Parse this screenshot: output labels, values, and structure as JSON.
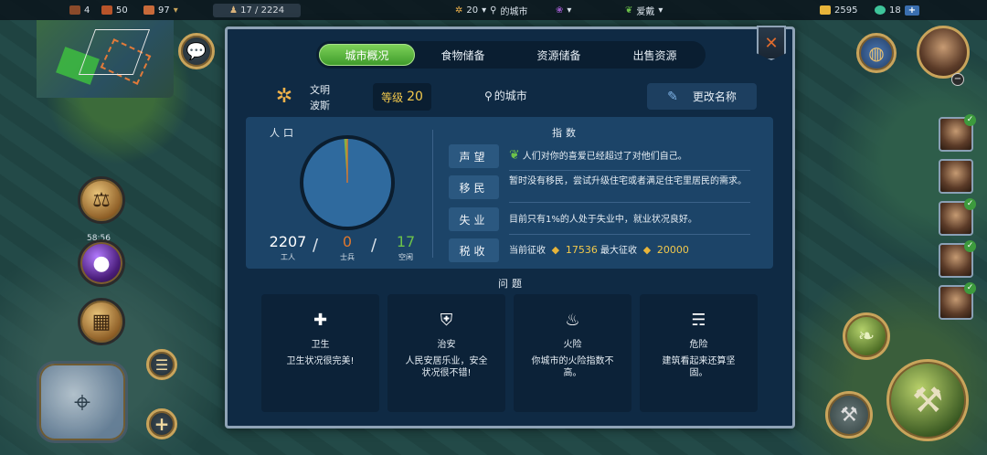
{
  "topbar": {
    "resource_a": "4",
    "resource_b": "50",
    "resource_c": "97",
    "population_counter": "17 / 2224",
    "civ_level": "20",
    "city_label": "的城市",
    "leader_label": "爱戴",
    "gold": "2595",
    "gems": "18",
    "add_label": "+"
  },
  "left": {
    "orb_timer": "58:56"
  },
  "tabs": [
    {
      "label": "城市概况",
      "active": true
    },
    {
      "label": "食物储备",
      "active": false
    },
    {
      "label": "资源储备",
      "active": false
    },
    {
      "label": "出售资源",
      "active": false
    }
  ],
  "city": {
    "civ_name": "文明",
    "civ_type": "波斯",
    "level_label": "等级",
    "level_value": "20",
    "city_name": "的城市",
    "rename_label": "更改名称"
  },
  "population": {
    "title": "人口",
    "workers_value": "2207",
    "workers_label": "工人",
    "soldiers_value": "0",
    "soldiers_label": "士兵",
    "idle_value": "17",
    "idle_label": "空闲",
    "colors": {
      "workers": "#2f6a9e",
      "soldiers": "#e0772d",
      "idle": "#6cc24a"
    }
  },
  "indices": {
    "title": "指数",
    "rows": [
      {
        "key": "声望",
        "text": "人们对你的喜爱已经超过了对他们自己。"
      },
      {
        "key": "移民",
        "text": "暂时没有移民，尝试升级住宅或者满足住宅里居民的需求。"
      },
      {
        "key": "失业",
        "text": "目前只有1%的人处于失业中，就业状况良好。"
      },
      {
        "key": "税收",
        "text_current": "当前征收",
        "current_value": "17536",
        "text_max": "最大征收",
        "max_value": "20000"
      }
    ]
  },
  "issues": {
    "title": "问题",
    "cards": [
      {
        "icon": "health-cross-icon",
        "name": "卫生",
        "desc": "卫生状况很完美!"
      },
      {
        "icon": "shield-icon",
        "name": "治安",
        "desc": "人民安居乐业，安全状况很不错!"
      },
      {
        "icon": "fire-icon",
        "name": "火险",
        "desc": "你城市的火险指数不高。"
      },
      {
        "icon": "tornado-icon",
        "name": "危险",
        "desc": "建筑看起来还算坚固。"
      }
    ]
  }
}
